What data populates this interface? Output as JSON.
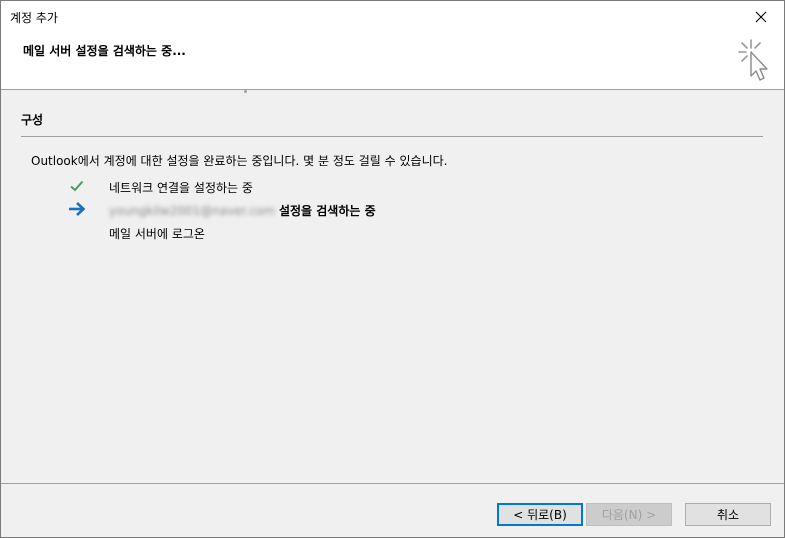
{
  "window": {
    "title": "계정 추가"
  },
  "header": {
    "title": "메일 서버 설정을 검색하는 중..."
  },
  "section": {
    "title": "구성"
  },
  "intro": "Outlook에서 계정에 대한 설정을 완료하는 중입니다. 몇 분 정도 걸릴 수 있습니다.",
  "steps": [
    {
      "icon": "checkmark-icon",
      "status": "done",
      "label": "네트워크 연결을 설정하는 중"
    },
    {
      "icon": "arrow-right-icon",
      "status": "in-progress",
      "email": "youngkilw2001@naver.com",
      "label": "설정을 검색하는 중"
    },
    {
      "icon": "",
      "status": "pending",
      "label": "메일 서버에 로그온"
    }
  ],
  "buttons": {
    "back": "< 뒤로(B)",
    "next": "다음(N) >",
    "cancel": "취소"
  },
  "colors": {
    "check": "#4a9a67",
    "arrow": "#1f6fc0",
    "accent": "#0078d7"
  }
}
